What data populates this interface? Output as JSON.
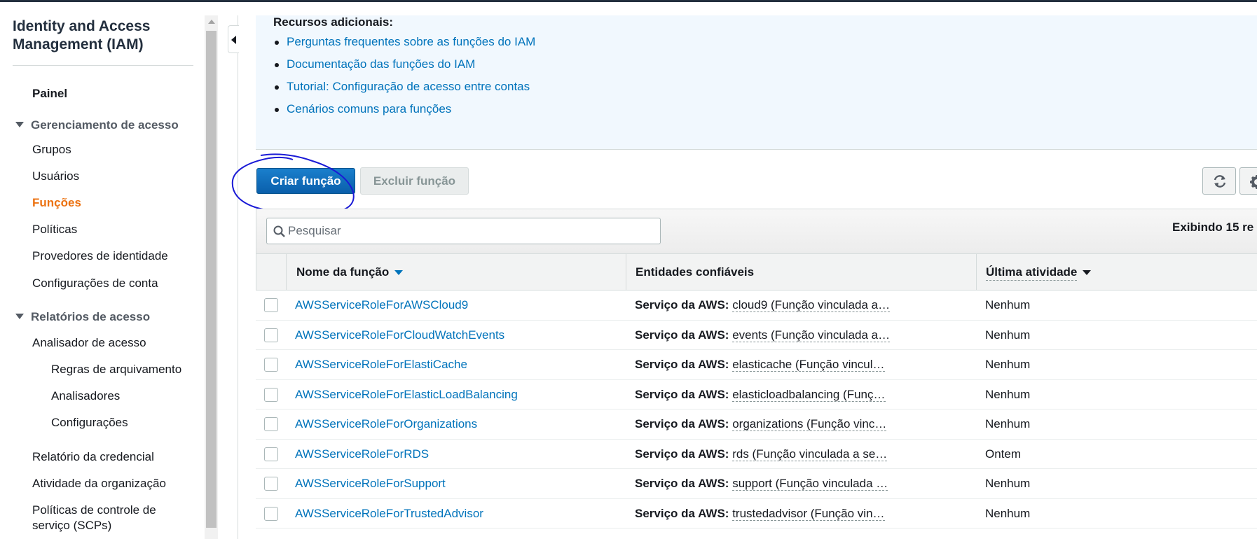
{
  "sidebar": {
    "title": "Identity and Access Management (IAM)",
    "dashboard": "Painel",
    "access_management": {
      "label": "Gerenciamento de acesso",
      "items": [
        "Grupos",
        "Usuários",
        "Funções",
        "Políticas",
        "Provedores de identidade",
        "Configurações de conta"
      ],
      "active": "Funções"
    },
    "access_reports": {
      "label": "Relatórios de acesso",
      "analyzer": "Analisador de acesso",
      "analyzer_items": [
        "Regras de arquivamento",
        "Analisadores",
        "Configurações"
      ],
      "items": [
        "Relatório da credencial",
        "Atividade da organização",
        "Políticas de controle de serviço (SCPs)"
      ]
    }
  },
  "info": {
    "title": "Recursos adicionais:",
    "links": [
      "Perguntas frequentes sobre as funções do IAM",
      "Documentação das funções do IAM",
      "Tutorial: Configuração de acesso entre contas",
      "Cenários comuns para funções"
    ]
  },
  "actions": {
    "create": "Criar função",
    "delete": "Excluir função",
    "refresh_icon": "refresh-icon",
    "settings_icon": "gear-icon"
  },
  "search": {
    "placeholder": "Pesquisar",
    "icon": "search-icon"
  },
  "showing_text": "Exibindo 15 re",
  "table": {
    "columns": [
      "Nome da função",
      "Entidades confiáveis",
      "Última atividade"
    ],
    "rows": [
      {
        "name": "AWSServiceRoleForAWSCloud9",
        "trusted_label": "Serviço da AWS:",
        "trusted_value": "cloud9 (Função vinculada a…",
        "activity": "Nenhum"
      },
      {
        "name": "AWSServiceRoleForCloudWatchEvents",
        "trusted_label": "Serviço da AWS:",
        "trusted_value": "events (Função vinculada a…",
        "activity": "Nenhum"
      },
      {
        "name": "AWSServiceRoleForElastiCache",
        "trusted_label": "Serviço da AWS:",
        "trusted_value": "elasticache (Função vincul…",
        "activity": "Nenhum"
      },
      {
        "name": "AWSServiceRoleForElasticLoadBalancing",
        "trusted_label": "Serviço da AWS:",
        "trusted_value": "elasticloadbalancing (Funç…",
        "activity": "Nenhum"
      },
      {
        "name": "AWSServiceRoleForOrganizations",
        "trusted_label": "Serviço da AWS:",
        "trusted_value": "organizations (Função vinc…",
        "activity": "Nenhum"
      },
      {
        "name": "AWSServiceRoleForRDS",
        "trusted_label": "Serviço da AWS:",
        "trusted_value": "rds (Função vinculada a se…",
        "activity": "Ontem"
      },
      {
        "name": "AWSServiceRoleForSupport",
        "trusted_label": "Serviço da AWS:",
        "trusted_value": "support (Função vinculada …",
        "activity": "Nenhum"
      },
      {
        "name": "AWSServiceRoleForTrustedAdvisor",
        "trusted_label": "Serviço da AWS:",
        "trusted_value": "trustedadvisor (Função vin…",
        "activity": "Nenhum"
      }
    ]
  },
  "colors": {
    "link": "#0073bb",
    "active_nav": "#ec7211",
    "primary_button": "#0a5fab",
    "annotation": "#1a1ad6",
    "info_bg": "#f1f8fe"
  }
}
